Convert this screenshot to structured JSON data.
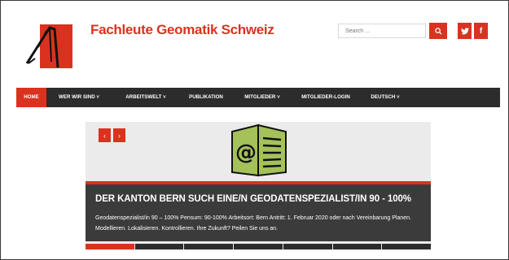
{
  "header": {
    "site_title": "Fachleute Geomatik Schweiz"
  },
  "search": {
    "placeholder": "Search ...",
    "button_icon": "search-icon"
  },
  "social": {
    "twitter_glyph": "🐦",
    "facebook_glyph": "f"
  },
  "nav": {
    "items": [
      {
        "label": "HOME"
      },
      {
        "label": "WER WIR SIND ˅"
      },
      {
        "label": "ARBEITSWELT ˅"
      },
      {
        "label": "PUBLIKATION"
      },
      {
        "label": "MITGLIEDER ˅"
      },
      {
        "label": "MITGLIEDER-LOGIN"
      },
      {
        "label": "DEUTSCH ˅"
      }
    ]
  },
  "slider": {
    "prev_glyph": "‹",
    "next_glyph": "›",
    "slide_title": "DER KANTON BERN SUCH EINE/N GEODATENSPEZIALIST/IN 90 - 100%",
    "slide_text": "Geodatenspezialist/in 90 – 100%  Pensum: 90-100% Arbeitsort: Bern Antritt: 1. Februar 2020 oder nach Vereinbarung  Planen. Modellieren. Lokalisieren. Kontrollieren. Ihre Zukunft?  Peilen Sie uns an.",
    "pager_count": 7,
    "active_index": 0
  },
  "colors": {
    "accent": "#d9331f",
    "nav_bg": "#2c2c2c",
    "caption_bg": "#3b3b3b",
    "icon_green": "#a4c15a"
  }
}
